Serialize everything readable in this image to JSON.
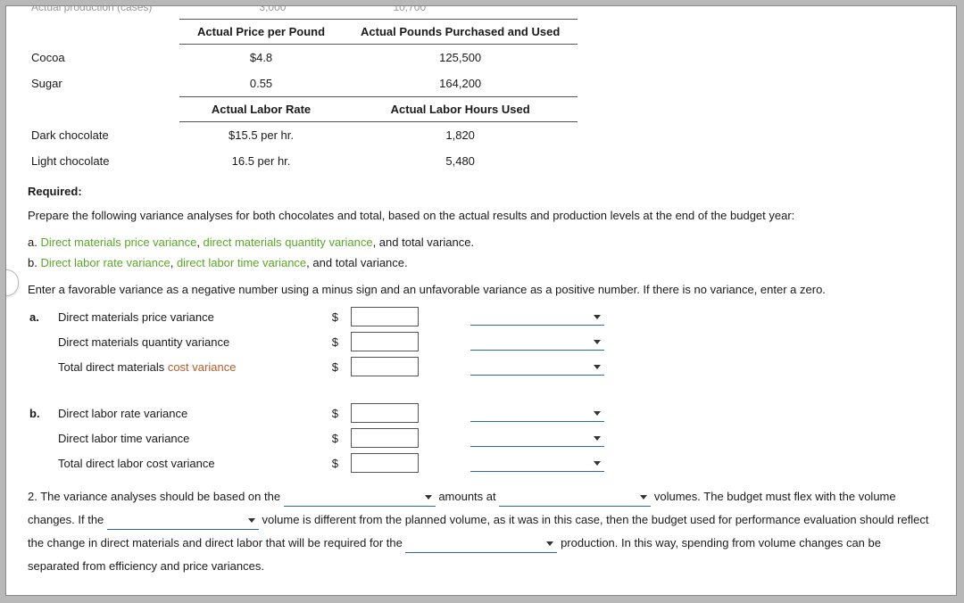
{
  "topcut": {
    "a": "Actual production (cases)",
    "b": "3,000",
    "c": "10,700"
  },
  "table1": {
    "h1": "Actual Price per Pound",
    "h2": "Actual Pounds Purchased and Used",
    "r1": {
      "label": "Cocoa",
      "price": "$4.8",
      "qty": "125,500"
    },
    "r2": {
      "label": "Sugar",
      "price": "0.55",
      "qty": "164,200"
    }
  },
  "table2": {
    "h1": "Actual Labor Rate",
    "h2": "Actual Labor Hours Used",
    "r1": {
      "label": "Dark chocolate",
      "rate": "$15.5 per hr.",
      "hrs": "1,820"
    },
    "r2": {
      "label": "Light chocolate",
      "rate": "16.5 per hr.",
      "hrs": "5,480"
    }
  },
  "required": "Required:",
  "prep": "Prepare the following variance analyses for both chocolates and total, based on the actual results and production levels at the end of the budget year:",
  "line_a": {
    "pre": "a. ",
    "l1": "Direct materials price variance",
    "mid": ", ",
    "l2": "direct materials quantity variance",
    "post": ", and total variance."
  },
  "line_b": {
    "pre": "b. ",
    "l1": "Direct labor rate variance",
    "mid": ", ",
    "l2": "direct labor time variance",
    "post": ", and total variance."
  },
  "instr": "Enter a favorable variance as a negative number using a minus sign and an unfavorable variance as a positive number. If there is no variance, enter a zero.",
  "groupA": {
    "lab": "a.",
    "r1": "Direct materials price variance",
    "r2": "Direct materials quantity variance",
    "r3pre": "Total direct materials ",
    "r3link": "cost variance"
  },
  "groupB": {
    "lab": "b.",
    "r1": "Direct labor rate variance",
    "r2": "Direct labor time variance",
    "r3": "Total direct labor cost variance"
  },
  "dollar": "$",
  "q2": {
    "pre": "2.  The variance analyses should be based on the ",
    "t1": " amounts at ",
    "t2": " volumes. The budget must flex with the volume changes. If the ",
    "t3": " volume is different from the planned volume, as it was in this case, then the budget used for performance evaluation should reflect the change in direct materials and direct labor that will be required for the ",
    "t4": " production. In this way, spending from volume changes can be separated from efficiency and price variances."
  }
}
